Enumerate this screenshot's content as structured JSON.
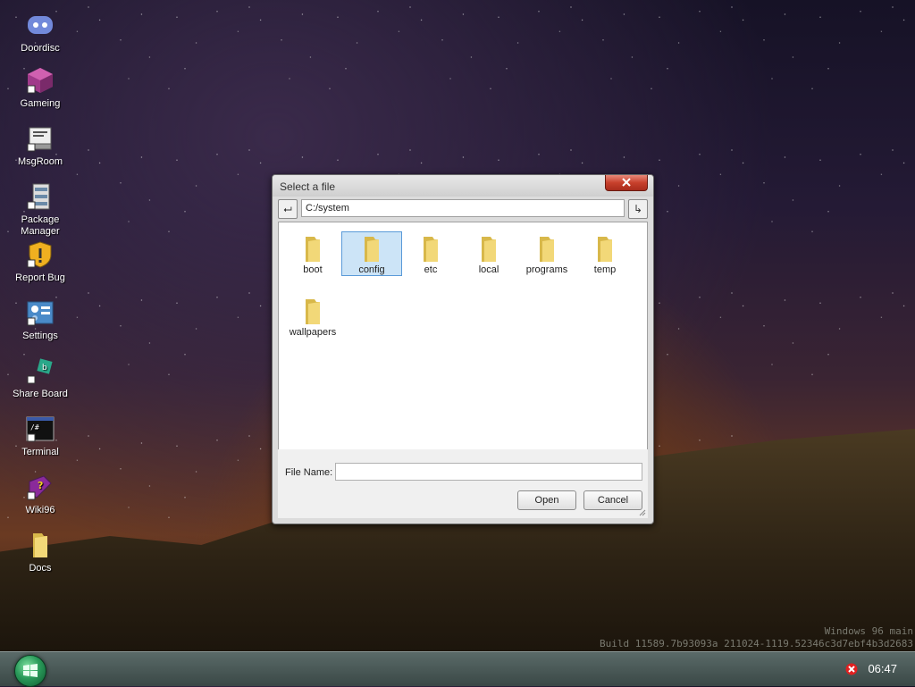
{
  "desktop": {
    "icons": [
      {
        "label": "Doordisc",
        "icon": "chat-controller-icon"
      },
      {
        "label": "Gameing",
        "icon": "cube-icon"
      },
      {
        "label": "MsgRoom",
        "icon": "message-icon"
      },
      {
        "label": "Package Manager",
        "icon": "package-icon"
      },
      {
        "label": "Report Bug",
        "icon": "shield-warning-icon"
      },
      {
        "label": "Settings",
        "icon": "settings-panel-icon"
      },
      {
        "label": "Share Board",
        "icon": "share-icon"
      },
      {
        "label": "Terminal",
        "icon": "terminal-icon"
      },
      {
        "label": "Wiki96",
        "icon": "book-help-icon"
      },
      {
        "label": "Docs",
        "icon": "folder-icon"
      }
    ]
  },
  "dialog": {
    "title": "Select a file",
    "path": "C:/system",
    "back_glyph": "⮠",
    "go_glyph": "↳",
    "files": [
      {
        "name": "boot",
        "selected": false
      },
      {
        "name": "config",
        "selected": true
      },
      {
        "name": "etc",
        "selected": false
      },
      {
        "name": "local",
        "selected": false
      },
      {
        "name": "programs",
        "selected": false
      },
      {
        "name": "temp",
        "selected": false
      },
      {
        "name": "wallpapers",
        "selected": false
      }
    ],
    "file_name_label": "File Name:",
    "file_name_value": "",
    "open_label": "Open",
    "cancel_label": "Cancel"
  },
  "watermark": {
    "line1": "Windows 96 main",
    "line2": "Build 11589.7b93093a 211024-1119.52346c3d7ebf4b3d2683"
  },
  "taskbar": {
    "clock": "06:47"
  },
  "colors": {
    "selection": "#cce4f7",
    "close_button": "#c8402c",
    "taskbar": "#4a5856"
  }
}
